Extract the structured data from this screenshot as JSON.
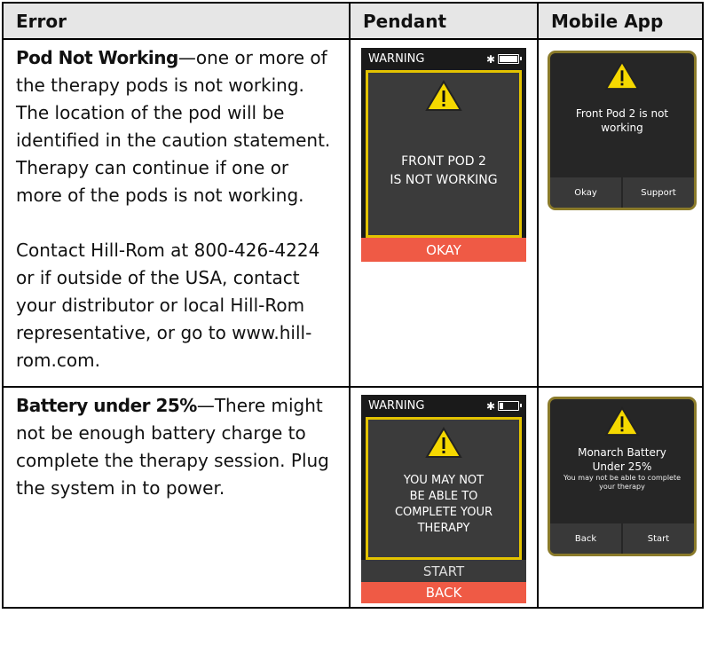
{
  "headers": {
    "error": "Error",
    "pendant": "Pendant",
    "mobile": "Mobile App"
  },
  "rows": [
    {
      "title": "Pod Not Working",
      "text": "—one or more of the therapy pods is not working. The location of the pod will be identified in the caution statement. Therapy can continue if one or more of the pods is not working.",
      "contact": "Contact Hill-Rom at 800-426-4224 or if outside of the USA, contact your distributor or local Hill-Rom representative, or go to www.hill-rom.com.",
      "pendant": {
        "status": "WARNING",
        "message_line1": "FRONT POD 2",
        "message_line2": "IS NOT WORKING",
        "button": "OKAY",
        "battery_level": 1.0
      },
      "mobile": {
        "message_line1": "Front Pod 2 is not",
        "message_line2": "working",
        "left_button": "Okay",
        "right_button": "Support"
      }
    },
    {
      "title": "Battery under 25%",
      "text": "—There might not be enough battery charge to complete the therapy session. Plug the system in to power.",
      "pendant": {
        "status": "WARNING",
        "message_line1": "YOU MAY NOT",
        "message_line2": "BE ABLE TO",
        "message_line3": "COMPLETE YOUR",
        "message_line4": "THERAPY",
        "button_top": "START",
        "button_bottom": "BACK",
        "battery_level": 0.2
      },
      "mobile": {
        "message_line1": "Monarch Battery",
        "message_line2": "Under 25%",
        "sub_line1": "You may not be able to complete",
        "sub_line2": "your therapy",
        "left_button": "Back",
        "right_button": "Start"
      }
    }
  ],
  "colors": {
    "warning_yellow": "#e3c300",
    "button_red": "#ef5a45",
    "screen_gray": "#3b3b3b"
  }
}
